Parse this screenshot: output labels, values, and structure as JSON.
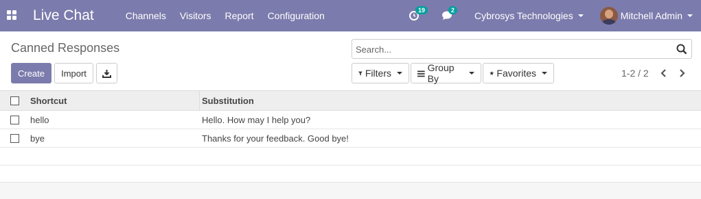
{
  "navbar": {
    "app_name": "Live Chat",
    "menu": [
      "Channels",
      "Visitors",
      "Report",
      "Configuration"
    ],
    "activity_badge": "19",
    "messages_badge": "2",
    "company": "Cybrosys Technologies",
    "user": "Mitchell Admin",
    "color": "#7c7bad"
  },
  "control_panel": {
    "title": "Canned Responses",
    "create_label": "Create",
    "import_label": "Import",
    "search_placeholder": "Search...",
    "filters_label": "Filters",
    "group_by_label": "Group By",
    "favorites_label": "Favorites",
    "pager": "1-2 / 2"
  },
  "table": {
    "headers": [
      "Shortcut",
      "Substitution"
    ],
    "rows": [
      {
        "shortcut": "hello",
        "substitution": "Hello. How may I help you?"
      },
      {
        "shortcut": "bye",
        "substitution": "Thanks for your feedback. Good bye!"
      }
    ]
  },
  "icons": {
    "apps": "apps-grid-icon",
    "activity": "clock-icon",
    "messages": "comments-icon",
    "search": "search-icon",
    "download": "download-icon",
    "filter": "filter-icon",
    "group": "bars-icon",
    "favorites": "star-icon",
    "prev": "chevron-left-icon",
    "next": "chevron-right-icon"
  }
}
